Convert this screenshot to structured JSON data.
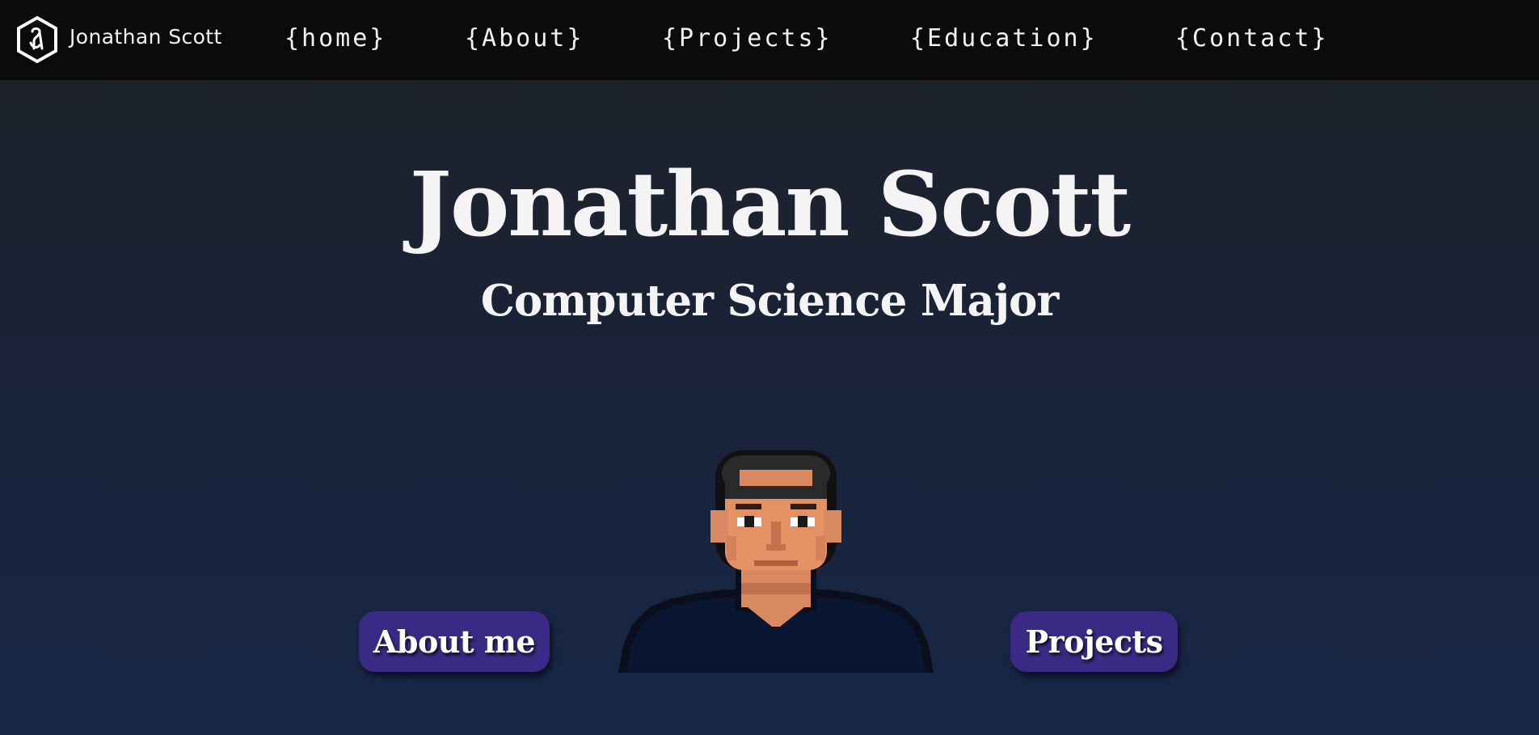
{
  "navbar": {
    "brand_name": "Jonathan Scott",
    "logo_icon": "hexagon-monogram-icon",
    "links": [
      {
        "label": "{home}"
      },
      {
        "label": "{About}"
      },
      {
        "label": "{Projects}"
      },
      {
        "label": "{Education}"
      },
      {
        "label": "{Contact}"
      }
    ]
  },
  "hero": {
    "title": "Jonathan Scott",
    "subtitle": "Computer Science Major",
    "avatar_icon": "pixel-art-avatar"
  },
  "buttons": {
    "about_label": "About me",
    "projects_label": "Projects"
  },
  "colors": {
    "navbar_bg": "#0b0b0b",
    "button_bg": "#3a2a85",
    "text": "#f4f4f4"
  }
}
